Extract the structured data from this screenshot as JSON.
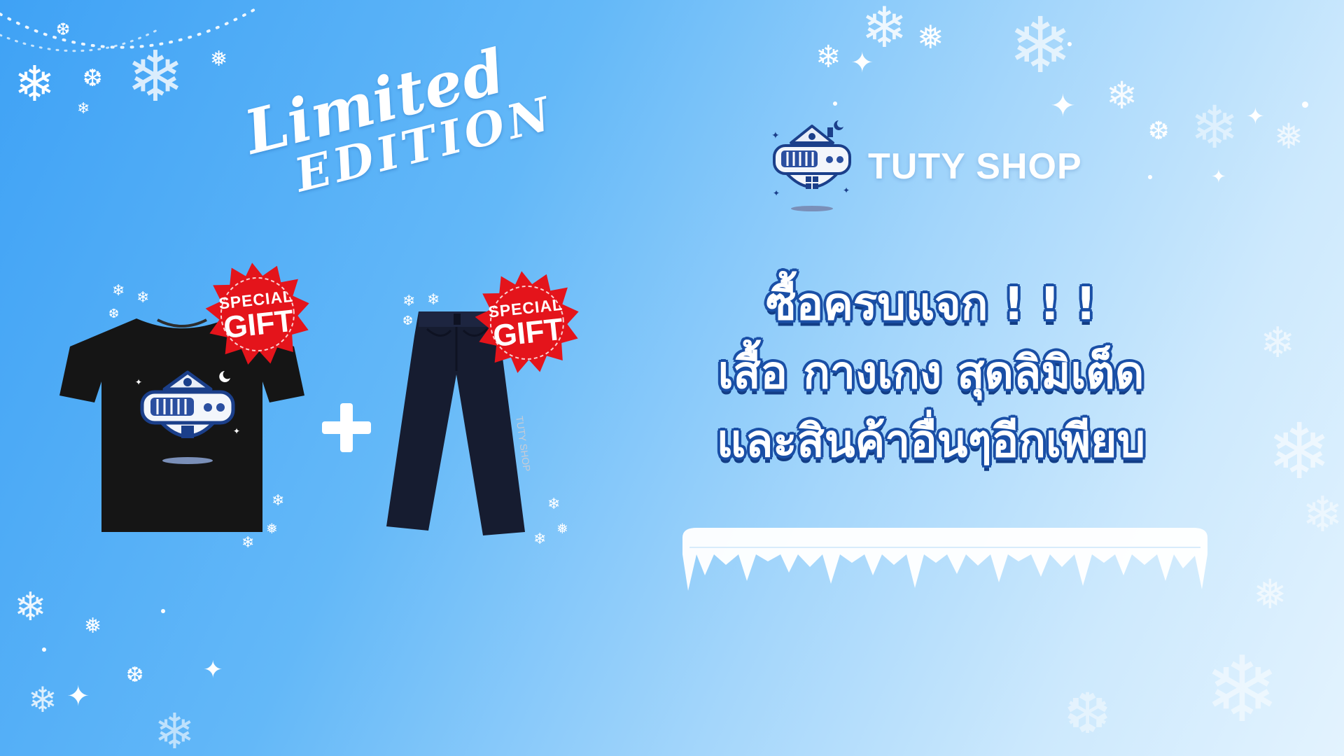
{
  "badge": {
    "limited_line1": "Limited",
    "limited_line2": "EDITION"
  },
  "brand": {
    "name": "TUTY SHOP"
  },
  "products": {
    "shirt_badge_top": "SPECIAL",
    "shirt_badge_bottom": "GIFT",
    "pants_badge_top": "SPECIAL",
    "pants_badge_bottom": "GIFT",
    "pants_print": "TUTY SHOP"
  },
  "promo": {
    "line1": "ซื้อครบแจก ! ! !",
    "line2": "เสื้อ กางเกง สุดลิมิเต็ด",
    "line3": "และสินค้าอื่นๆอีกเพียบ"
  },
  "colors": {
    "background_start": "#3fa2f5",
    "background_end": "#e3f3fe",
    "badge_red": "#e4141b",
    "text_outline": "#1a4fa6",
    "shirt": "#151515",
    "pants": "#161c30"
  },
  "icons": [
    "snowflake-icon",
    "shop-logo-icon",
    "special-gift-badge-icon",
    "plus-icon",
    "icicle-decoration"
  ]
}
